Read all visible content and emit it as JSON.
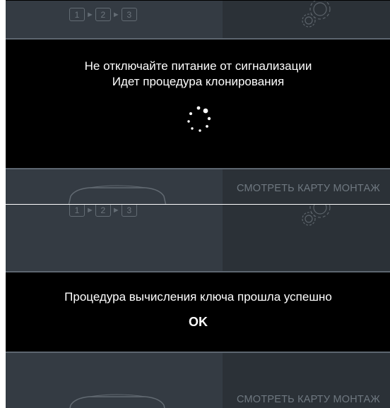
{
  "top_screen": {
    "steps": [
      "1",
      "2",
      "3"
    ],
    "message_line1": "Не отключайте питание от сигнализации",
    "message_line2": "Идет процедура клонирования",
    "mount_map_link": "СМОТРЕТЬ КАРТУ МОНТАЖ"
  },
  "bottom_screen": {
    "steps": [
      "1",
      "2",
      "3"
    ],
    "message": "Процедура вычисления ключа прошла успешно",
    "ok_label": "OK",
    "mount_map_link": "СМОТРЕТЬ КАРТУ МОНТАЖ"
  },
  "colors": {
    "overlay": "#000000",
    "background": "#2f353c",
    "text": "#ffffff"
  },
  "icons": [
    "gear-icon",
    "car-icon",
    "loading-spinner-icon"
  ]
}
